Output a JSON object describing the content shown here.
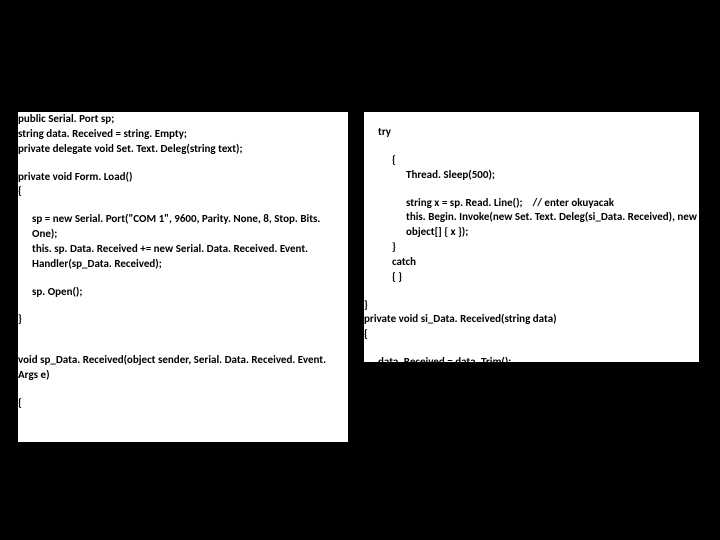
{
  "left": {
    "l1": "public Serial. Port sp;",
    "l2": "string data. Received = string. Empty;",
    "l3": "private delegate void Set. Text. Deleg(string text);",
    "l4": "private void Form. Load()",
    "l5": "{",
    "l6": "sp = new Serial. Port(\"COM 1\", 9600, Parity. None, 8, Stop. Bits. One);",
    "l7": "this. sp. Data. Received += new Serial. Data. Received. Event. Handler(sp_Data. Received);",
    "l8": "sp. Open();",
    "l9": "}",
    "l10": "void sp_Data. Received(object sender, Serial. Data. Received. Event. Args e)",
    "l11": "{"
  },
  "right": {
    "r1": "try",
    "r2": "{",
    "r3": "Thread. Sleep(500);",
    "r4": "string x = sp. Read. Line();    // enter okuyacak",
    "r5": "this. Begin. Invoke(new Set. Text. Deleg(si_Data. Received), new object[] { x });",
    "r6": "}",
    "r7": "catch",
    "r8": "{ }",
    "r9": "}",
    "r10": "private void si_Data. Received(string data)",
    "r11": "{",
    "r12": "data. Received = data. Trim();",
    "r13": "}"
  }
}
